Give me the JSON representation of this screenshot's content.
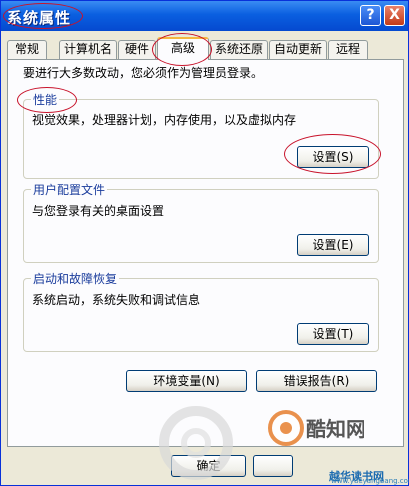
{
  "window": {
    "title": "系统属性",
    "help_icon": "?",
    "close_icon": "X"
  },
  "tabs": [
    {
      "label": "常规"
    },
    {
      "label": "计算机名"
    },
    {
      "label": "硬件"
    },
    {
      "label": "高级",
      "active": true
    },
    {
      "label": "系统还原"
    },
    {
      "label": "自动更新"
    },
    {
      "label": "远程"
    }
  ],
  "notice": "要进行大多数改动，您必须作为管理员登录。",
  "groups": {
    "performance": {
      "label": "性能",
      "desc": "视觉效果，处理器计划，内存使用，以及虚拟内存",
      "button": "设置(S)"
    },
    "profiles": {
      "label": "用户配置文件",
      "desc": "与您登录有关的桌面设置",
      "button": "设置(E)"
    },
    "startup": {
      "label": "启动和故障恢复",
      "desc": "系统启动，系统失败和调试信息",
      "button": "设置(T)"
    }
  },
  "bottom_buttons": {
    "env": "环境变量(N)",
    "error": "错误报告(R)"
  },
  "dialog_buttons": {
    "ok": "确定"
  },
  "watermark": {
    "big": "酷知网",
    "small": "越华读书网",
    "site": "www.yueyangbang.com"
  },
  "colors": {
    "titlebar": "#0a5fe0",
    "annotation": "#c8132b",
    "group_label": "#1a3c9c"
  }
}
